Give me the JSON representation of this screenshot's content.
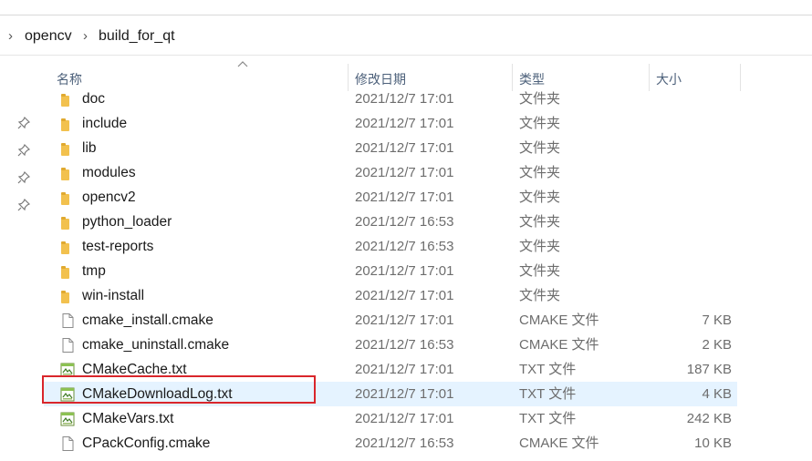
{
  "breadcrumb": {
    "items": [
      "opencv",
      "build_for_qt"
    ]
  },
  "columns": {
    "name": "名称",
    "modified": "修改日期",
    "type": "类型",
    "size": "大小"
  },
  "files": [
    {
      "name": "doc",
      "date": "2021/12/7 17:01",
      "type": "文件夹",
      "size": "",
      "icon": "folder-icon"
    },
    {
      "name": "include",
      "date": "2021/12/7 17:01",
      "type": "文件夹",
      "size": "",
      "icon": "folder-icon"
    },
    {
      "name": "lib",
      "date": "2021/12/7 17:01",
      "type": "文件夹",
      "size": "",
      "icon": "folder-icon"
    },
    {
      "name": "modules",
      "date": "2021/12/7 17:01",
      "type": "文件夹",
      "size": "",
      "icon": "folder-icon"
    },
    {
      "name": "opencv2",
      "date": "2021/12/7 17:01",
      "type": "文件夹",
      "size": "",
      "icon": "folder-icon"
    },
    {
      "name": "python_loader",
      "date": "2021/12/7 16:53",
      "type": "文件夹",
      "size": "",
      "icon": "folder-icon"
    },
    {
      "name": "test-reports",
      "date": "2021/12/7 16:53",
      "type": "文件夹",
      "size": "",
      "icon": "folder-icon"
    },
    {
      "name": "tmp",
      "date": "2021/12/7 17:01",
      "type": "文件夹",
      "size": "",
      "icon": "folder-icon"
    },
    {
      "name": "win-install",
      "date": "2021/12/7 17:01",
      "type": "文件夹",
      "size": "",
      "icon": "folder-icon"
    },
    {
      "name": "cmake_install.cmake",
      "date": "2021/12/7 17:01",
      "type": "CMAKE 文件",
      "size": "7 KB",
      "icon": "file-icon"
    },
    {
      "name": "cmake_uninstall.cmake",
      "date": "2021/12/7 16:53",
      "type": "CMAKE 文件",
      "size": "2 KB",
      "icon": "file-icon"
    },
    {
      "name": "CMakeCache.txt",
      "date": "2021/12/7 17:01",
      "type": "TXT 文件",
      "size": "187 KB",
      "icon": "text-file-icon"
    },
    {
      "name": "CMakeDownloadLog.txt",
      "date": "2021/12/7 17:01",
      "type": "TXT 文件",
      "size": "4 KB",
      "icon": "text-file-icon",
      "selected": true
    },
    {
      "name": "CMakeVars.txt",
      "date": "2021/12/7 17:01",
      "type": "TXT 文件",
      "size": "242 KB",
      "icon": "text-file-icon"
    },
    {
      "name": "CPackConfig.cmake",
      "date": "2021/12/7 16:53",
      "type": "CMAKE 文件",
      "size": "10 KB",
      "icon": "file-icon"
    }
  ],
  "colors": {
    "selection": "#e5f3ff",
    "highlight_border": "#d9262b",
    "folder": "#f2c14e"
  }
}
